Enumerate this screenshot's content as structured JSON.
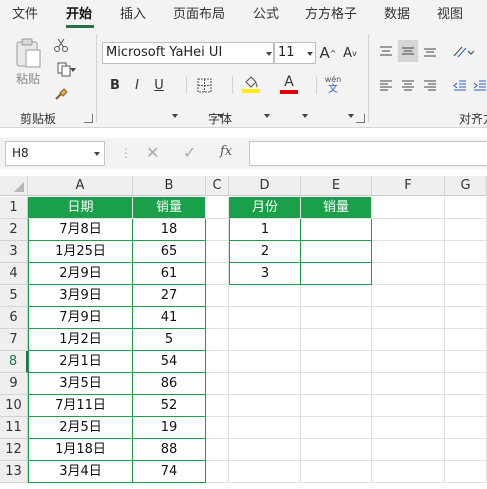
{
  "ribbon_tabs": [
    "文件",
    "开始",
    "插入",
    "页面布局",
    "公式",
    "方方格子",
    "数据",
    "视图"
  ],
  "clipboard": {
    "paste_label": "粘贴",
    "group_label": "剪贴板"
  },
  "font": {
    "name": "Microsoft YaHei UI",
    "size": "11",
    "bold": "B",
    "italic": "I",
    "underline": "U",
    "font_color_glyph": "A",
    "grow": "A",
    "shrink": "A",
    "phonetic_top": "wén",
    "phonetic_bottom": "文",
    "group_label": "字体"
  },
  "alignment": {
    "group_label": "对齐方"
  },
  "name_box": "H8",
  "fx_label": "fx",
  "colors": {
    "accent": "#217346",
    "table_header": "#1aa04a"
  },
  "sheet": {
    "columns": [
      "A",
      "B",
      "C",
      "D",
      "E",
      "F",
      "G"
    ],
    "rows": [
      "1",
      "2",
      "3",
      "4",
      "5",
      "6",
      "7",
      "8",
      "9",
      "10",
      "11",
      "12",
      "13"
    ],
    "selected_row": "8",
    "table1_headers": [
      "日期",
      "销量"
    ],
    "table1": [
      [
        "7月8日",
        "18"
      ],
      [
        "1月25日",
        "65"
      ],
      [
        "2月9日",
        "61"
      ],
      [
        "3月9日",
        "27"
      ],
      [
        "7月9日",
        "41"
      ],
      [
        "1月2日",
        "5"
      ],
      [
        "2月1日",
        "54"
      ],
      [
        "3月5日",
        "86"
      ],
      [
        "7月11日",
        "52"
      ],
      [
        "2月5日",
        "19"
      ],
      [
        "1月18日",
        "88"
      ],
      [
        "3月4日",
        "74"
      ]
    ],
    "table2_headers": [
      "月份",
      "销量"
    ],
    "table2": [
      [
        "1",
        ""
      ],
      [
        "2",
        ""
      ],
      [
        "3",
        ""
      ]
    ]
  }
}
